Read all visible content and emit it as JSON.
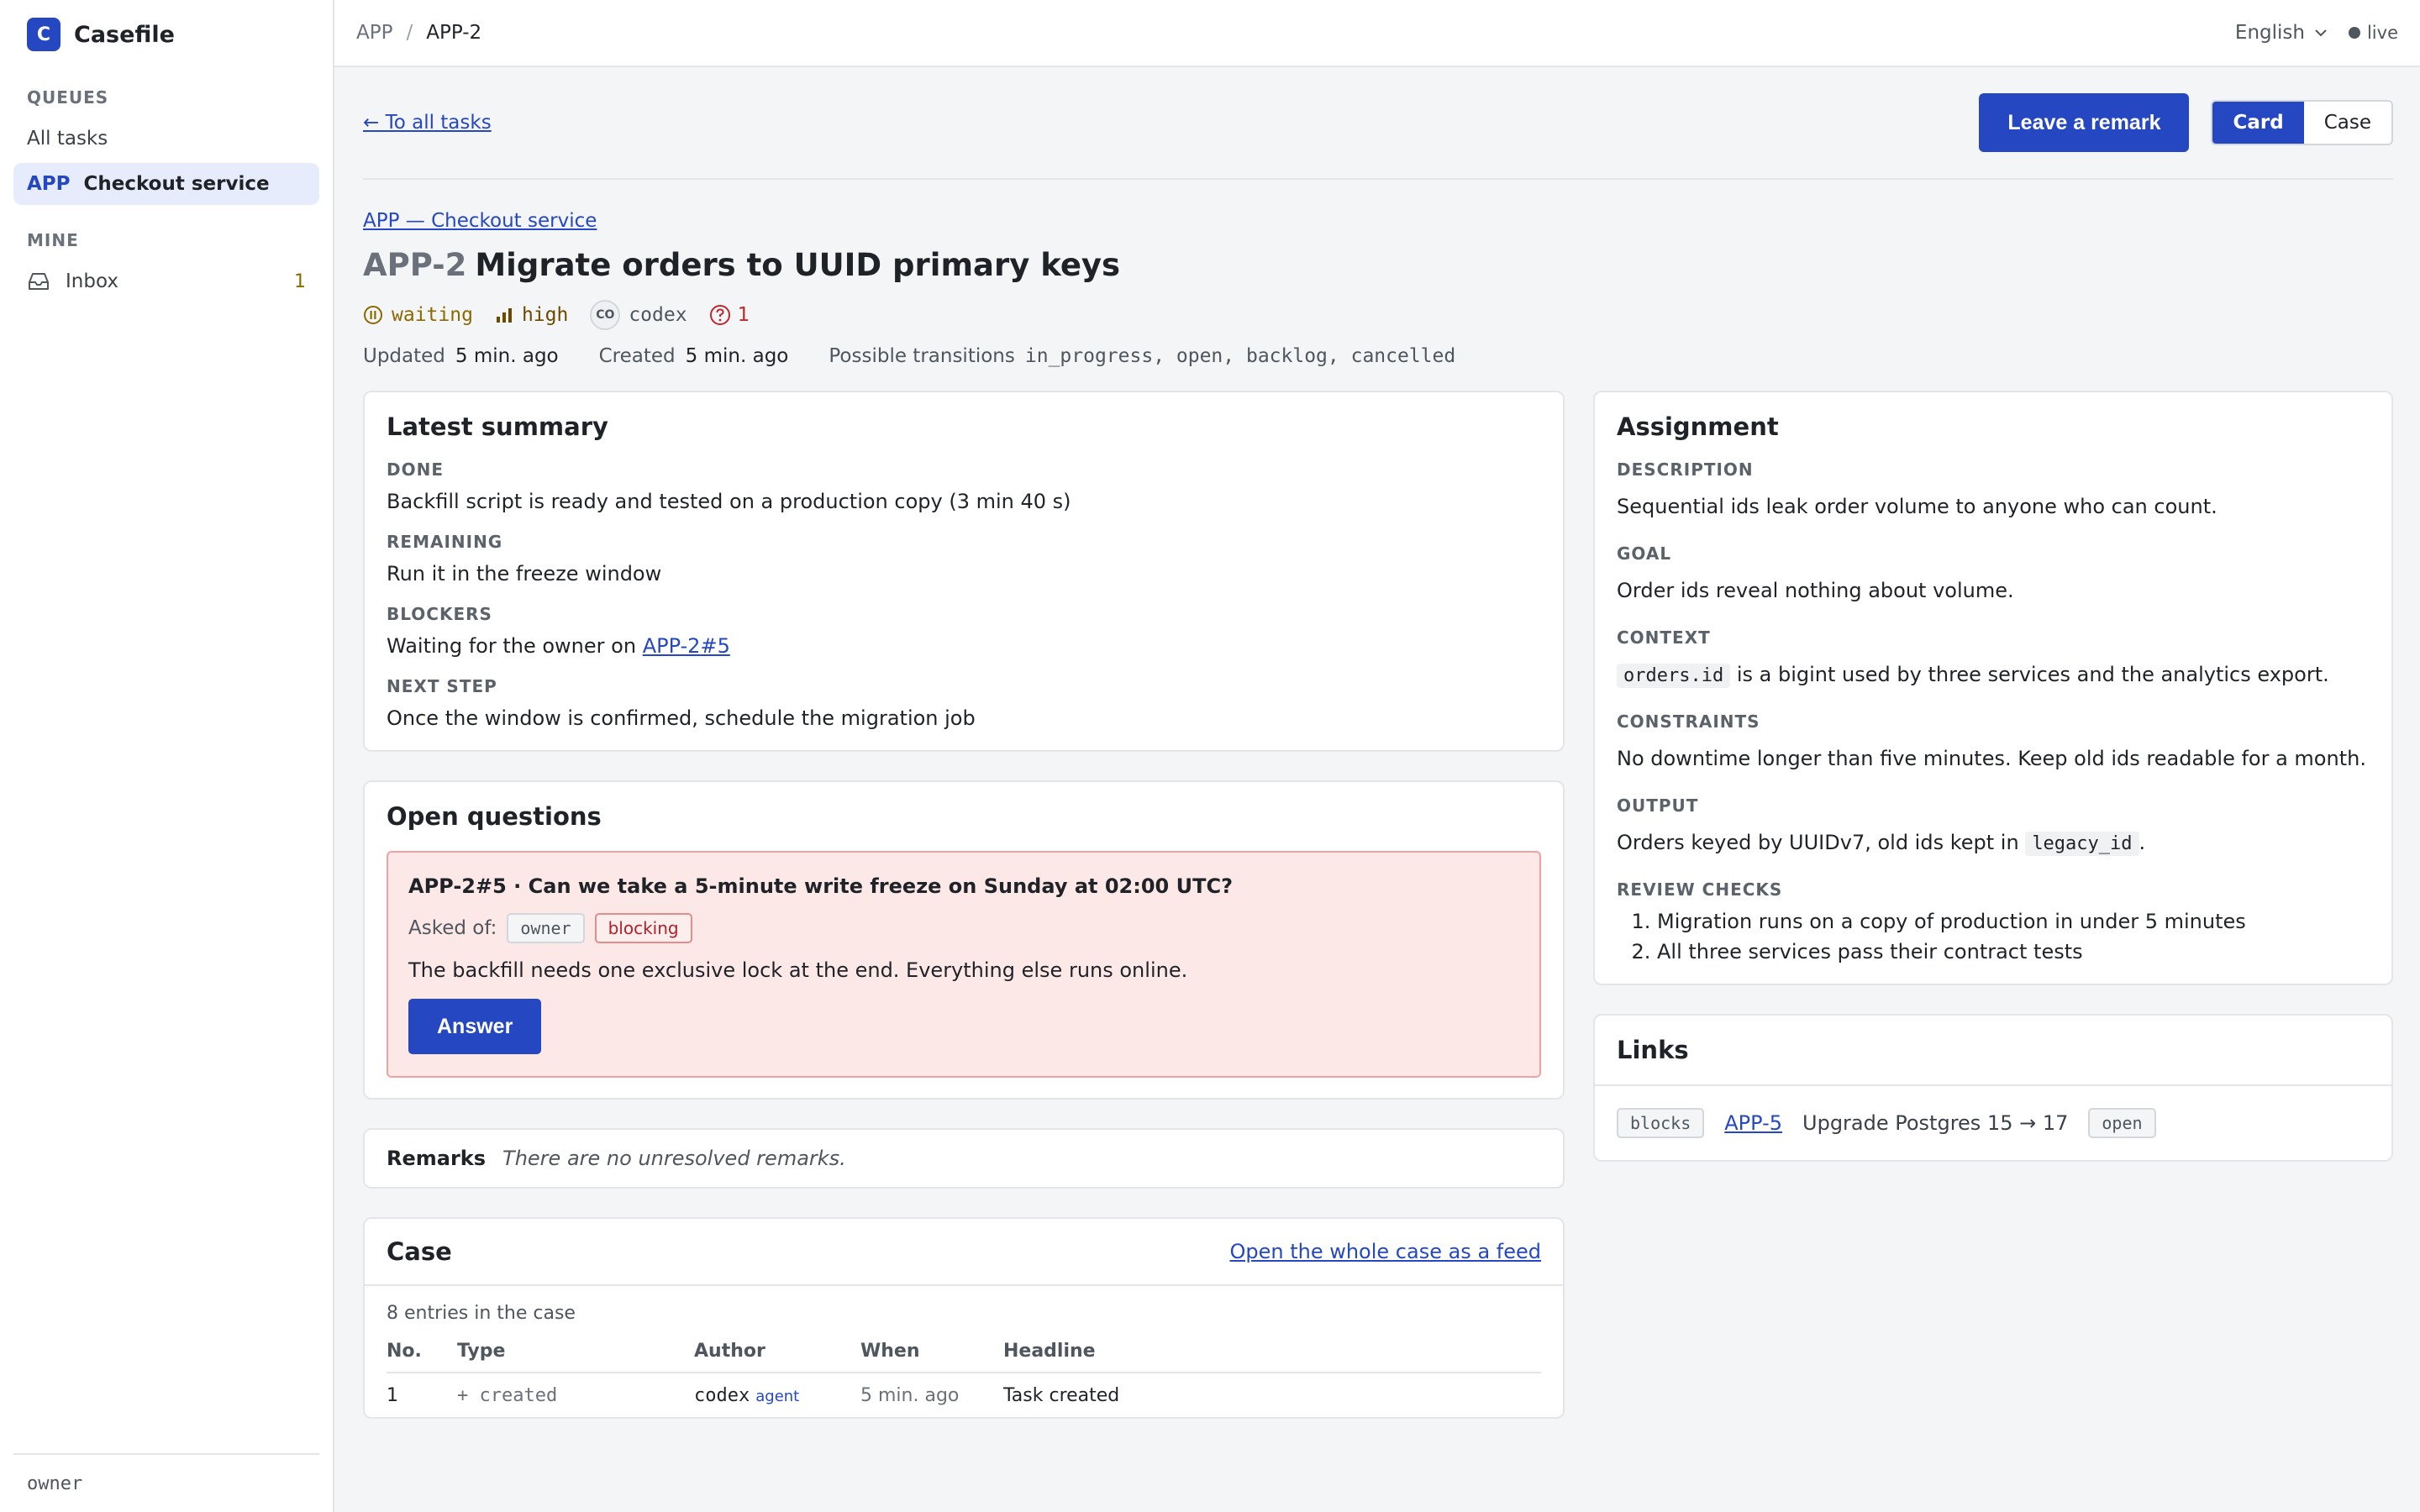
{
  "app": {
    "logo_letter": "C",
    "name": "Casefile"
  },
  "sidebar": {
    "queues_label": "QUEUES",
    "all_tasks": "All tasks",
    "active_prefix": "APP",
    "active_label": "Checkout service",
    "mine_label": "MINE",
    "inbox_label": "Inbox",
    "inbox_count": "1",
    "footer_user": "owner"
  },
  "topbar": {
    "crumb_root": "APP",
    "crumb_sep": "/",
    "crumb_current": "APP-2",
    "language": "English",
    "live": "live"
  },
  "actions": {
    "back": "← To all tasks",
    "leave_remark": "Leave a remark",
    "view_card": "Card",
    "view_case": "Case"
  },
  "task": {
    "project_link": "APP — Checkout service",
    "key": "APP-2",
    "title": "Migrate orders to UUID primary keys",
    "status": "waiting",
    "priority": "high",
    "assignee_initials": "CO",
    "assignee": "codex",
    "question_count": "1",
    "updated_label": "Updated",
    "updated_value": "5 min. ago",
    "created_label": "Created",
    "created_value": "5 min. ago",
    "transitions_label": "Possible transitions",
    "transitions": "in_progress, open, backlog, cancelled"
  },
  "summary": {
    "title": "Latest summary",
    "done_label": "DONE",
    "done": "Backfill script is ready and tested on a production copy (3 min 40 s)",
    "remaining_label": "REMAINING",
    "remaining": "Run it in the freeze window",
    "blockers_label": "BLOCKERS",
    "blockers_text": "Waiting for the owner on ",
    "blockers_link": "APP-2#5",
    "next_label": "NEXT STEP",
    "next": "Once the window is confirmed, schedule the migration job"
  },
  "questions": {
    "title": "Open questions",
    "q_title": "APP-2#5 · Can we take a 5-minute write freeze on Sunday at 02:00 UTC?",
    "asked_of_label": "Asked of:",
    "asked_of": "owner",
    "blocking": "blocking",
    "body": "The backfill needs one exclusive lock at the end. Everything else runs online.",
    "answer": "Answer"
  },
  "remarks": {
    "title": "Remarks",
    "empty": "There are no unresolved remarks."
  },
  "case": {
    "title": "Case",
    "feed_link": "Open the whole case as a feed",
    "count": "8 entries in the case",
    "columns": [
      "No.",
      "Type",
      "Author",
      "When",
      "Headline"
    ],
    "rows": [
      {
        "no": "1",
        "type": "+ created",
        "author": "codex",
        "author_tag": "agent",
        "when": "5 min. ago",
        "headline": "Task created"
      }
    ]
  },
  "assignment": {
    "title": "Assignment",
    "description_label": "DESCRIPTION",
    "description": "Sequential ids leak order volume to anyone who can count.",
    "goal_label": "GOAL",
    "goal": "Order ids reveal nothing about volume.",
    "context_label": "CONTEXT",
    "context_code": "orders.id",
    "context_rest": " is a bigint used by three services and the analytics export.",
    "constraints_label": "CONSTRAINTS",
    "constraints": "No downtime longer than five minutes. Keep old ids readable for a month.",
    "output_label": "OUTPUT",
    "output_text": "Orders keyed by UUIDv7, old ids kept in ",
    "output_code": "legacy_id",
    "output_end": ".",
    "review_label": "REVIEW CHECKS",
    "review": [
      "Migration runs on a copy of production in under 5 minutes",
      "All three services pass their contract tests"
    ]
  },
  "links": {
    "title": "Links",
    "relation": "blocks",
    "target_key": "APP-5",
    "target_title": "Upgrade Postgres 15 → 17",
    "target_status": "open"
  },
  "colors": {
    "accent": "#2548c2",
    "warning": "#8a6a00",
    "danger": "#c0262d",
    "question_bg": "#fde8e8"
  }
}
